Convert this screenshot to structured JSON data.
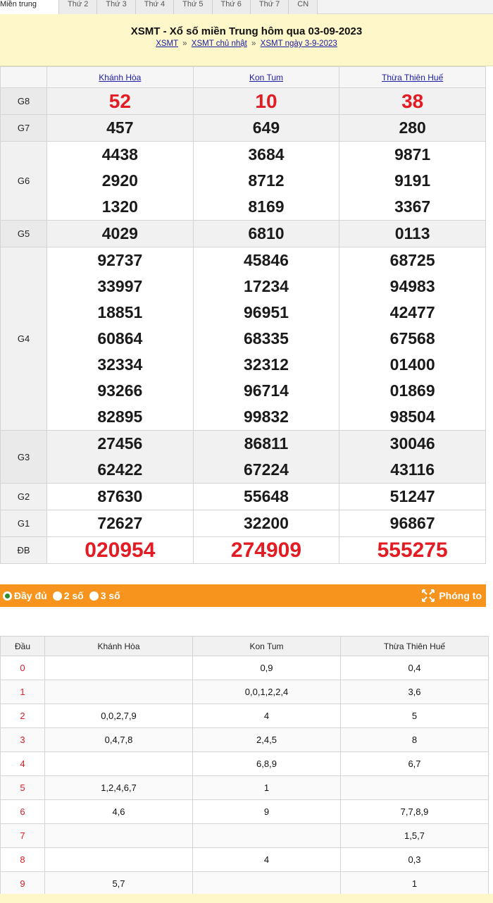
{
  "tabs": [
    "Miền trung",
    "Thứ 2",
    "Thứ 3",
    "Thứ 4",
    "Thứ 5",
    "Thứ 6",
    "Thứ 7",
    "CN"
  ],
  "header": {
    "title": "XSMT - Xổ số miền Trung hôm qua 03-09-2023",
    "crumbs": [
      "XSMT",
      "XSMT chủ nhật",
      "XSMT ngày 3-9-2023"
    ],
    "separator": "»"
  },
  "provinces": [
    "Khánh Hòa",
    "Kon Tum",
    "Thừa Thiên Huế"
  ],
  "results": [
    {
      "label": "G8",
      "values": [
        [
          "52"
        ],
        [
          "10"
        ],
        [
          "38"
        ]
      ]
    },
    {
      "label": "G7",
      "values": [
        [
          "457"
        ],
        [
          "649"
        ],
        [
          "280"
        ]
      ]
    },
    {
      "label": "G6",
      "values": [
        [
          "4438",
          "2920",
          "1320"
        ],
        [
          "3684",
          "8712",
          "8169"
        ],
        [
          "9871",
          "9191",
          "3367"
        ]
      ]
    },
    {
      "label": "G5",
      "values": [
        [
          "4029"
        ],
        [
          "6810"
        ],
        [
          "0113"
        ]
      ]
    },
    {
      "label": "G4",
      "values": [
        [
          "92737",
          "33997",
          "18851",
          "60864",
          "32334",
          "93266",
          "82895"
        ],
        [
          "45846",
          "17234",
          "96951",
          "68335",
          "32312",
          "96714",
          "99832"
        ],
        [
          "68725",
          "94983",
          "42477",
          "67568",
          "01400",
          "01869",
          "98504"
        ]
      ]
    },
    {
      "label": "G3",
      "values": [
        [
          "27456",
          "62422"
        ],
        [
          "86811",
          "67224"
        ],
        [
          "30046",
          "43116"
        ]
      ]
    },
    {
      "label": "G2",
      "values": [
        [
          "87630"
        ],
        [
          "55648"
        ],
        [
          "51247"
        ]
      ]
    },
    {
      "label": "G1",
      "values": [
        [
          "72627"
        ],
        [
          "32200"
        ],
        [
          "96867"
        ]
      ]
    },
    {
      "label": "ĐB",
      "values": [
        [
          "020954"
        ],
        [
          "274909"
        ],
        [
          "555275"
        ]
      ]
    }
  ],
  "options": {
    "full": "Đầy đủ",
    "two": "2 số",
    "three": "3 số",
    "selected": "full",
    "zoom": "Phóng to"
  },
  "loto": {
    "head_label": "Đầu",
    "rows": [
      {
        "d": "0",
        "v": [
          "",
          "0,9",
          "0,4"
        ]
      },
      {
        "d": "1",
        "v": [
          "",
          "0,0,1,2,2,4",
          "3,6"
        ]
      },
      {
        "d": "2",
        "v": [
          "0,0,2,7,9",
          "4",
          "5"
        ]
      },
      {
        "d": "3",
        "v": [
          "0,4,7,8",
          "2,4,5",
          "8"
        ]
      },
      {
        "d": "4",
        "v": [
          "",
          "6,8,9",
          "6,7"
        ]
      },
      {
        "d": "5",
        "v": [
          "1,2,4,6,7",
          "1",
          ""
        ]
      },
      {
        "d": "6",
        "v": [
          "4,6",
          "9",
          "7,7,8,9"
        ]
      },
      {
        "d": "7",
        "v": [
          "",
          "",
          "1,5,7"
        ]
      },
      {
        "d": "8",
        "v": [
          "",
          "4",
          "0,3"
        ]
      },
      {
        "d": "9",
        "v": [
          "5,7",
          "",
          "1"
        ]
      }
    ]
  },
  "colors": {
    "accent": "#f7941d",
    "special": "#e31b23",
    "header_bg": "#fdf7c9",
    "link": "#1a1aa6"
  }
}
